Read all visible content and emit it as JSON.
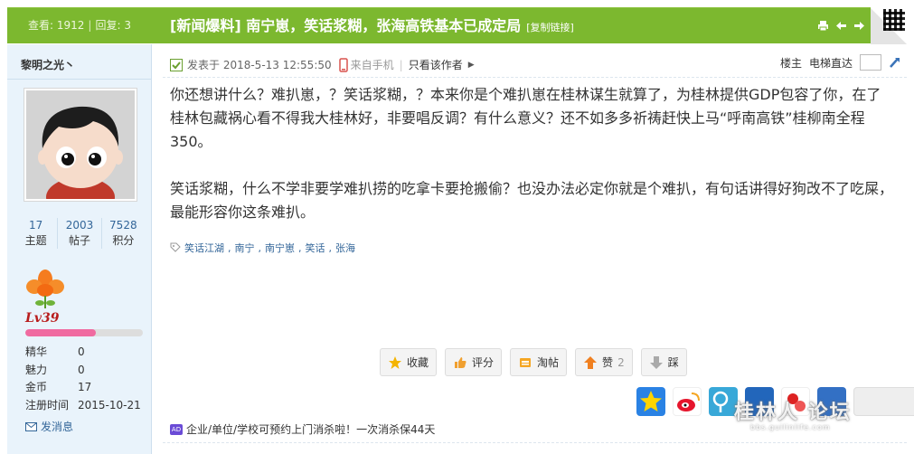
{
  "thread": {
    "views_label": "查看:",
    "views": "1912",
    "replies_label": "回复:",
    "replies": "3",
    "title": "[新闻爆料] 南宁崽，笑话浆糊，张海高铁基本已成定局",
    "copy_link": "[复制链接]"
  },
  "author": {
    "name": "黎明之光丶",
    "stats": [
      {
        "num": "17",
        "label": "主题"
      },
      {
        "num": "2003",
        "label": "帖子"
      },
      {
        "num": "7528",
        "label": "积分"
      }
    ],
    "level": "Lv39",
    "level_progress": 0.6,
    "profile": [
      {
        "k": "精华",
        "v": "0"
      },
      {
        "k": "魅力",
        "v": "0"
      },
      {
        "k": "金币",
        "v": "17"
      },
      {
        "k": "注册时间",
        "v": "2015-10-21"
      }
    ],
    "send_message": "发消息"
  },
  "post": {
    "posted_at": "发表于 2018-5-13 12:55:50",
    "from_mobile": "来自手机",
    "only_author": "只看该作者",
    "floor": "楼主",
    "elevator": "电梯直达",
    "paragraphs": [
      "你还想讲什么？难扒崽，？笑话浆糊，？本来你是个难扒崽在桂林谋生就算了，为桂林提供GDP包容了你，在了桂林包藏祸心看不得我大桂林好，非要唱反调？有什么意义？还不如多多祈祷赶快上马“呼南高铁”桂柳南全程350。",
      "笑话浆糊，什么不学非要学难扒捞的吃拿卡要抢搬偷？也没办法必定你就是个难扒，有句话讲得好狗改不了吃屎，最能形容你这条难扒。"
    ],
    "tags": [
      "笑话江湖",
      "南宁",
      "南宁崽",
      "笑话",
      "张海"
    ]
  },
  "actions": {
    "favorite": "收藏",
    "rate": "评分",
    "tao": "淘帖",
    "like": "赞",
    "like_count": "2",
    "dislike": "踩"
  },
  "ad": {
    "badge": "AD",
    "text": "企业/单位/学校可预约上门消杀啦！一次消杀保44天"
  },
  "watermark": {
    "text": "桂林人 论坛",
    "sub": "bbs.guilinlife.com"
  },
  "colors": {
    "header": "#7cb82f",
    "sidebar": "#e9f3fb",
    "link": "#336699",
    "level": "#b81c1c"
  }
}
